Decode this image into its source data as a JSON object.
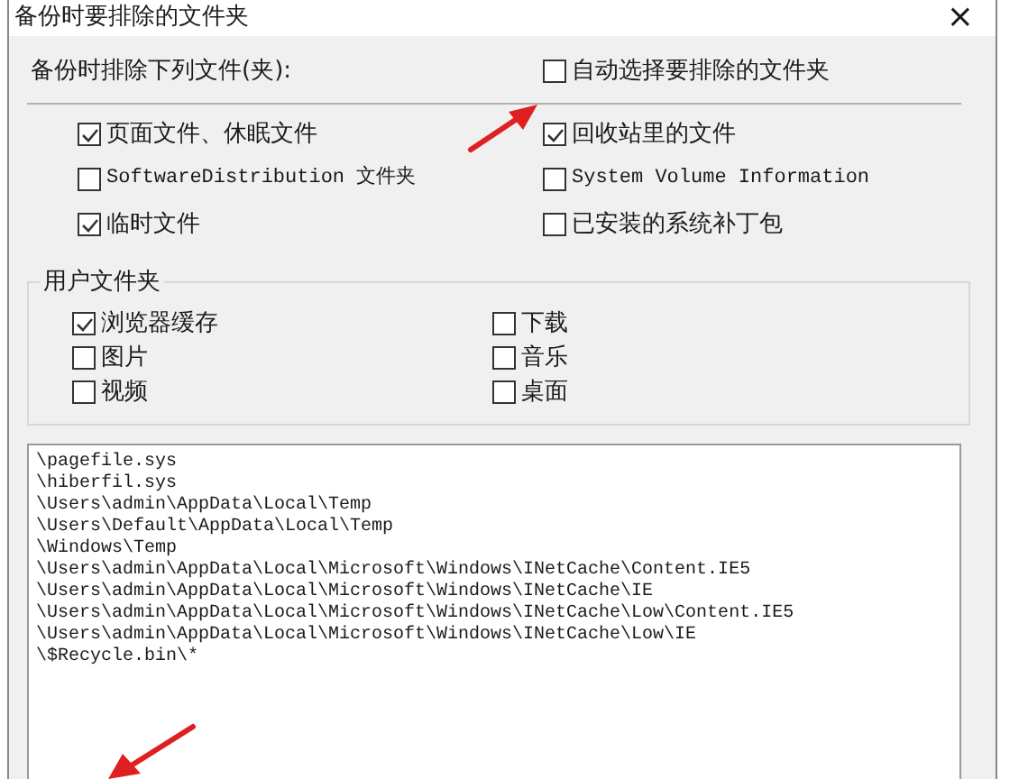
{
  "window": {
    "title": "备份时要排除的文件夹",
    "close": "×"
  },
  "header": {
    "label": "备份时排除下列文件(夹):",
    "auto_select": {
      "label": "自动选择要排除的文件夹",
      "checked": false
    }
  },
  "system_items": [
    {
      "label": "页面文件、休眠文件",
      "checked": true,
      "kind": "cjk"
    },
    {
      "label": "回收站里的文件",
      "checked": true,
      "kind": "cjk"
    },
    {
      "label": "SoftwareDistribution 文件夹",
      "checked": false,
      "kind": "mono"
    },
    {
      "label": "System Volume Information",
      "checked": false,
      "kind": "mono"
    },
    {
      "label": "临时文件",
      "checked": true,
      "kind": "cjk"
    },
    {
      "label": "已安装的系统补丁包",
      "checked": false,
      "kind": "cjk"
    }
  ],
  "user_folders": {
    "title": "用户文件夹",
    "items": [
      {
        "label": "浏览器缓存",
        "checked": true
      },
      {
        "label": "下载",
        "checked": false
      },
      {
        "label": "图片",
        "checked": false
      },
      {
        "label": "音乐",
        "checked": false
      },
      {
        "label": "视频",
        "checked": false
      },
      {
        "label": "桌面",
        "checked": false
      }
    ]
  },
  "exclude_list": [
    "\\pagefile.sys",
    "\\hiberfil.sys",
    "\\Users\\admin\\AppData\\Local\\Temp",
    "\\Users\\Default\\AppData\\Local\\Temp",
    "\\Windows\\Temp",
    "\\Users\\admin\\AppData\\Local\\Microsoft\\Windows\\INetCache\\Content.IE5",
    "\\Users\\admin\\AppData\\Local\\Microsoft\\Windows\\INetCache\\IE",
    "\\Users\\admin\\AppData\\Local\\Microsoft\\Windows\\INetCache\\Low\\Content.IE5",
    "\\Users\\admin\\AppData\\Local\\Microsoft\\Windows\\INetCache\\Low\\IE",
    "\\$Recycle.bin\\*"
  ]
}
